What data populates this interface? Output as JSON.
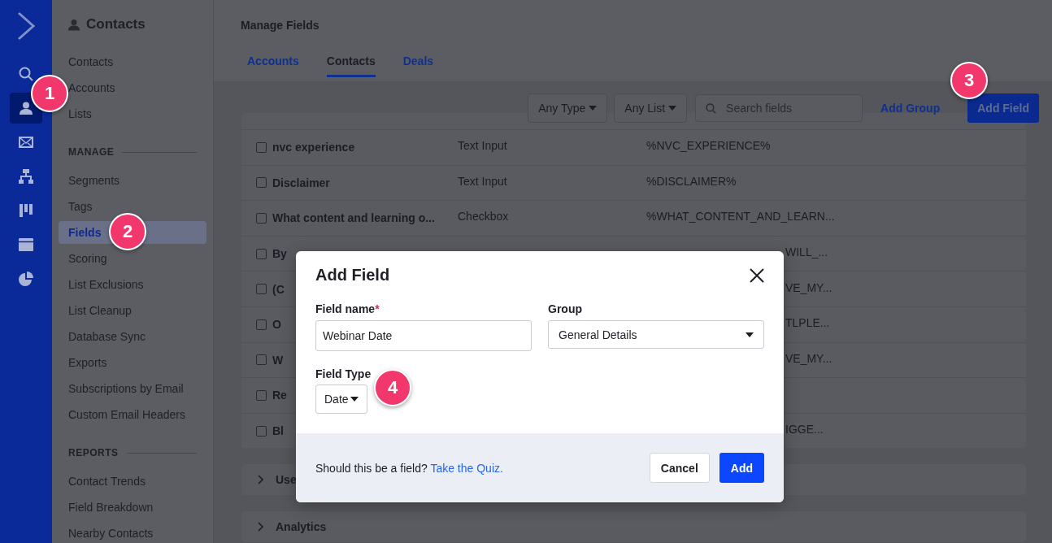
{
  "rail": {
    "items": [
      {
        "kind": "search",
        "selected": false
      },
      {
        "kind": "person",
        "selected": true
      },
      {
        "kind": "mail",
        "selected": false
      },
      {
        "kind": "sitemap",
        "selected": false
      },
      {
        "kind": "board",
        "selected": false
      },
      {
        "kind": "browser",
        "selected": false
      },
      {
        "kind": "pie",
        "selected": false
      }
    ]
  },
  "sidebar": {
    "title": "Contacts",
    "sections": [
      {
        "items": [
          {
            "label": "Contacts",
            "selected": false
          },
          {
            "label": "Accounts",
            "selected": false
          },
          {
            "label": "Lists",
            "selected": false
          }
        ]
      },
      {
        "heading": "MANAGE",
        "items": [
          {
            "label": "Segments",
            "selected": false
          },
          {
            "label": "Tags",
            "selected": false
          },
          {
            "label": "Fields",
            "selected": true
          },
          {
            "label": "Scoring",
            "selected": false
          },
          {
            "label": "List Exclusions",
            "selected": false
          },
          {
            "label": "List Cleanup",
            "selected": false
          },
          {
            "label": "Database Sync",
            "selected": false
          },
          {
            "label": "Exports",
            "selected": false
          },
          {
            "label": "Subscriptions by Email",
            "selected": false
          },
          {
            "label": "Custom Email Headers",
            "selected": false
          }
        ]
      },
      {
        "heading": "REPORTS",
        "items": [
          {
            "label": "Contact Trends",
            "selected": false
          },
          {
            "label": "Field Breakdown",
            "selected": false
          },
          {
            "label": "Nearby Contacts",
            "selected": false
          }
        ]
      }
    ]
  },
  "page_title": "Manage Fields",
  "tabs": [
    {
      "label": "Accounts",
      "selected": false
    },
    {
      "label": "Contacts",
      "selected": true
    },
    {
      "label": "Deals",
      "selected": false
    }
  ],
  "toolbar": {
    "filters": [
      "Any Type",
      "Any List"
    ],
    "search": {
      "placeholder": "Search fields"
    },
    "add_group": "Add Group",
    "add_field": "Add Field"
  },
  "rows": [
    {
      "kind": "full",
      "name": "nvc experience",
      "type": "Text Input",
      "code": "%NVC_EXPERIENCE%",
      "checked": false
    },
    {
      "kind": "full",
      "name": "Disclaimer",
      "type": "Text Input",
      "code": "%DISCLAIMER%",
      "checked": false
    },
    {
      "kind": "full",
      "name": "What content and learning o...",
      "type": "Checkbox",
      "code": "%WHAT_CONTENT_AND_LEARN...",
      "checked": false
    },
    {
      "kind": "covered",
      "name": "By",
      "code": "WILL_...",
      "checked": false
    },
    {
      "kind": "covered",
      "name": "(C",
      "code": "VE_MY...",
      "checked": false
    },
    {
      "kind": "covered",
      "name": "O",
      "code": "TLPLE...",
      "checked": false
    },
    {
      "kind": "covered",
      "name": "W",
      "code": "VE_MY...",
      "checked": false
    },
    {
      "kind": "covered",
      "name": "Re",
      "checked": false
    },
    {
      "kind": "covered",
      "name": "Bl",
      "code": "IGGE...",
      "checked": false
    }
  ],
  "groups": [
    {
      "label": "Use",
      "expanded": false
    },
    {
      "label": "Analytics",
      "expanded": false
    }
  ],
  "modal": {
    "title": "Add Field",
    "field_name": {
      "label": "Field name",
      "required_mark": "*",
      "value": "Webinar Date"
    },
    "group": {
      "label": "Group",
      "value": "General Details"
    },
    "field_type": {
      "label": "Field Type",
      "value": "Date"
    },
    "footer_text": "Should this be a field?",
    "footer_link": "Take the Quiz.",
    "cancel": "Cancel",
    "add": "Add"
  },
  "callouts": [
    "1",
    "2",
    "3",
    "4"
  ]
}
